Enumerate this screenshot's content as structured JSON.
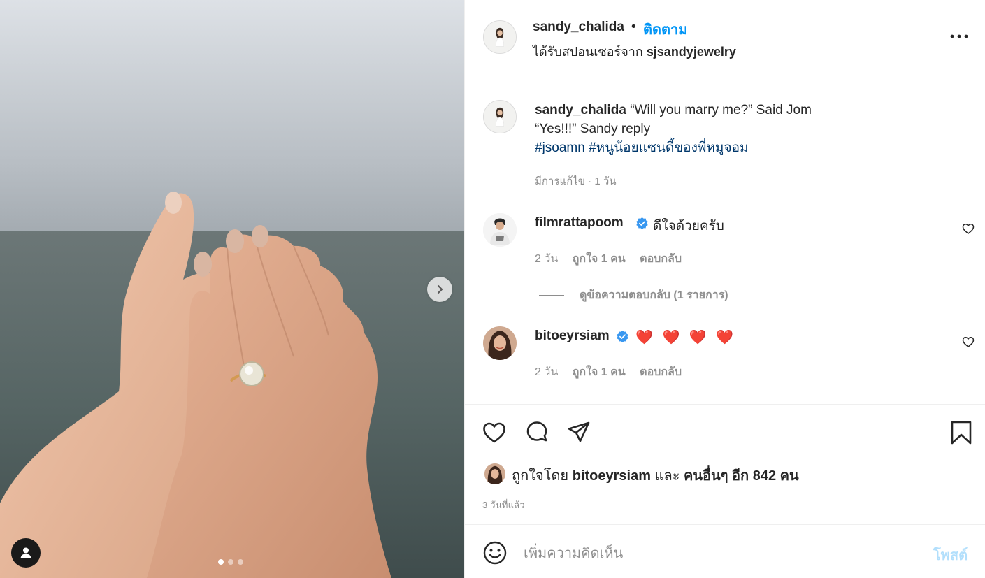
{
  "header": {
    "username": "sandy_chalida",
    "separator": "•",
    "follow_label": "ติดตาม",
    "sponsor_prefix": "ได้รับสปอนเซอร์จาก",
    "sponsor_name": "sjsandyjewelry"
  },
  "caption": {
    "username": "sandy_chalida",
    "line1": "“Will you marry me?” Said Jom",
    "line2": "“Yes!!!” Sandy reply",
    "hashtags": [
      "#jsoamn",
      "#หนูน้อยแซนดี้ของพี่หมูจอม"
    ],
    "meta": "มีการแก้ไข · 1 วัน"
  },
  "comments": [
    {
      "username": "filmrattapoom",
      "text": "ดีใจด้วยครับ",
      "age": "2 วัน",
      "likes": "ถูกใจ 1 คน",
      "reply": "ตอบกลับ",
      "view_replies": "ดูข้อความตอบกลับ (1 รายการ)"
    },
    {
      "username": "bitoeyrsiam",
      "text": "❤️ ❤️ ❤️ ❤️",
      "age": "2 วัน",
      "likes": "ถูกใจ 1 คน",
      "reply": "ตอบกลับ"
    }
  ],
  "likes": {
    "prefix": "ถูกใจโดย",
    "user": "bitoeyrsiam",
    "and": "และ",
    "others": "คนอื่นๆ อีก 842 คน"
  },
  "time_ago": "3 วันที่แล้ว",
  "comment_box": {
    "placeholder": "เพิ่มความคิดเห็น",
    "post_label": "โพสต์"
  },
  "carousel": {
    "total": 3,
    "active": 1
  },
  "icons": {
    "more": "more-horizontal-icon",
    "next": "chevron-right-icon",
    "user_tag": "user-tag-icon",
    "like": "heart-icon",
    "comment": "comment-icon",
    "share": "paper-plane-icon",
    "save": "bookmark-icon",
    "emoji": "emoji-icon",
    "verified": "verified-badge-icon"
  },
  "colors": {
    "accent": "#0095f6",
    "hashtag": "#00376b",
    "muted": "#8e8e8e",
    "verified": "#3897f0",
    "post_disabled": "#b2dffc"
  }
}
